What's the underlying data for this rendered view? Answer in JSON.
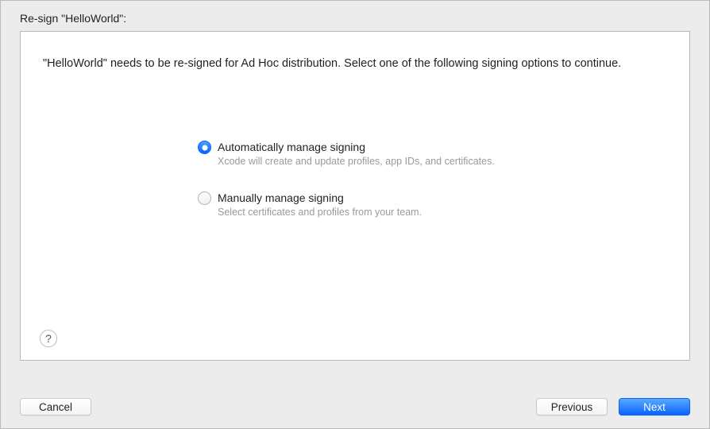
{
  "title": "Re-sign \"HelloWorld\":",
  "description": "\"HelloWorld\" needs to be re-signed for Ad Hoc distribution. Select one of the following signing options to continue.",
  "options": [
    {
      "label": "Automatically manage signing",
      "sublabel": "Xcode will create and update profiles, app IDs, and certificates.",
      "selected": true
    },
    {
      "label": "Manually manage signing",
      "sublabel": "Select certificates and profiles from your team.",
      "selected": false
    }
  ],
  "help_label": "?",
  "buttons": {
    "cancel": "Cancel",
    "previous": "Previous",
    "next": "Next"
  }
}
